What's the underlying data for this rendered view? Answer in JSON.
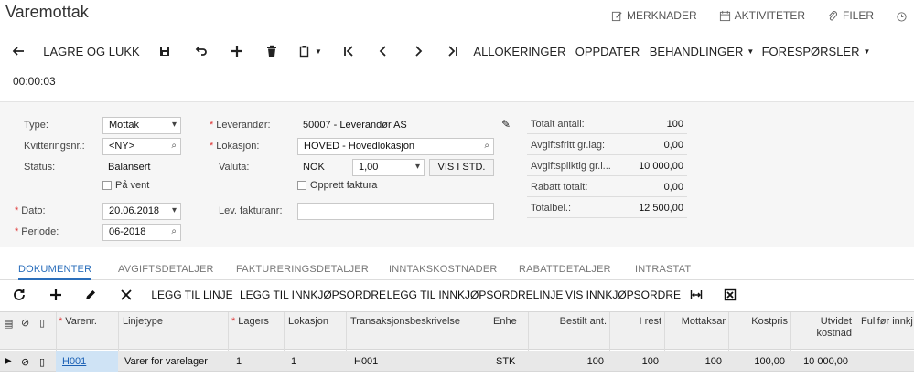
{
  "title": "Varemottak",
  "toplinks": [
    {
      "label": "MERKNADER",
      "icon": "note-icon"
    },
    {
      "label": "AKTIVITETER",
      "icon": "calendar-icon"
    },
    {
      "label": "FILER",
      "icon": "paperclip-icon"
    }
  ],
  "toolbar": {
    "back_icon": "arrow-left-icon",
    "save_close": "LAGRE OG LUKK",
    "allokeringer": "ALLOKERINGER",
    "oppdater": "OPPDATER",
    "behandlinger": "BEHANDLINGER",
    "foresporsler": "FORESPØRSLER"
  },
  "timer": "00:00:03",
  "form": {
    "type_label": "Type:",
    "type_value": "Mottak",
    "kvittering_label": "Kvitteringsnr.:",
    "kvittering_value": "<NY>",
    "status_label": "Status:",
    "status_value": "Balansert",
    "pa_vent_label": "På vent",
    "dato_label": "Dato:",
    "dato_value": "20.06.2018",
    "periode_label": "Periode:",
    "periode_value": "06-2018",
    "leverandor_label": "Leverandør:",
    "leverandor_value": "50007 - Leverandør AS",
    "lokasjon_label": "Lokasjon:",
    "lokasjon_value": "HOVED - Hovedlokasjon",
    "valuta_label": "Valuta:",
    "valuta_value": "NOK",
    "kurs_value": "1,00",
    "vis_i_std_label": "VIS I STD.",
    "opprett_faktura_label": "Opprett faktura",
    "lev_fakturanr_label": "Lev. fakturanr:",
    "lev_fakturanr_value": ""
  },
  "summary": [
    {
      "label": "Totalt antall:",
      "value": "100"
    },
    {
      "label": "Avgiftsfritt gr.lag:",
      "value": "0,00"
    },
    {
      "label": "Avgiftspliktig gr.l...",
      "value": "10 000,00"
    },
    {
      "label": "Rabatt totalt:",
      "value": "0,00"
    },
    {
      "label": "Totalbel.:",
      "value": "12 500,00"
    }
  ],
  "tabs": [
    "DOKUMENTER",
    "AVGIFTSDETALJER",
    "FAKTURERINGSDETALJER",
    "INNTAKSKOSTNADER",
    "RABATTDETALJER",
    "INTRASTAT"
  ],
  "grid_toolbar": {
    "add_line": "LEGG TIL LINJE",
    "add_po": "LEGG TIL INNKJØPSORDRE",
    "add_po_line": "LEGG TIL INNKJØPSORDRELINJE",
    "view_po": "VIS INNKJØPSORDRE"
  },
  "columns": {
    "varenr": "Varenr.",
    "linjetype": "Linjetype",
    "lagers": "Lagers",
    "lokasjon": "Lokasjon",
    "transaksjon": "Transaksjonsbeskrivelse",
    "enhet": "Enhe",
    "bestilt": "Bestilt ant.",
    "irest": "I rest",
    "mottaksar": "Mottaksar",
    "kostpris": "Kostpris",
    "utvidet_1": "Utvidet",
    "utvidet_2": "kostnad",
    "fullfor": "Fullfør innkj"
  },
  "row": {
    "varenr": "H001",
    "linjetype": "Varer for varelager",
    "lagers": "1",
    "lokasjon": "1",
    "transaksjon": "H001",
    "enhet": "STK",
    "bestilt": "100",
    "irest": "100",
    "mottaksar": "100",
    "kostpris": "100,00",
    "utvidet": "10 000,00"
  }
}
